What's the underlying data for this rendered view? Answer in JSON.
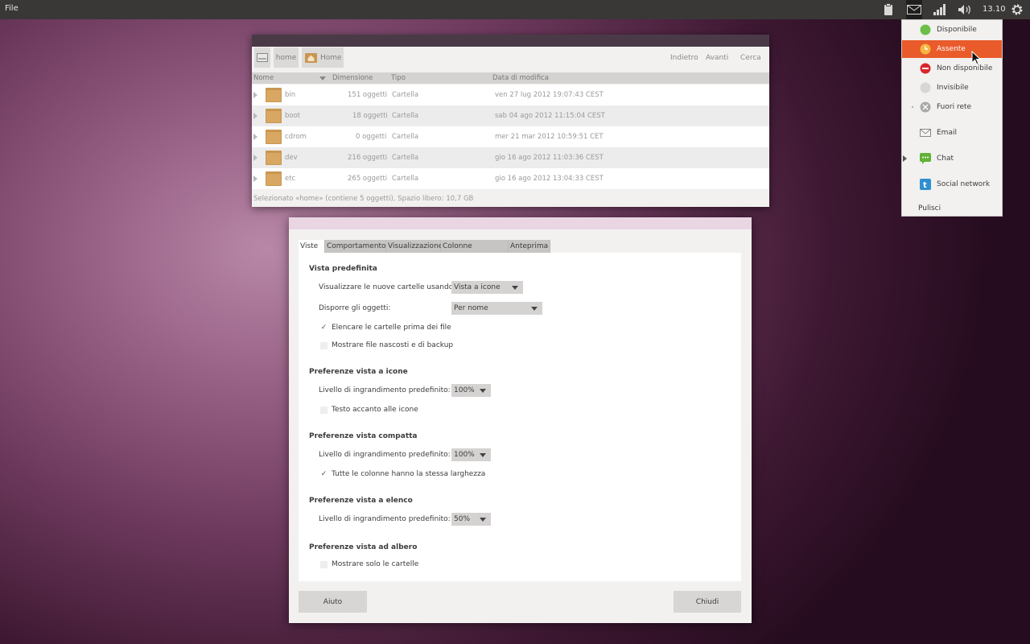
{
  "top_panel": {
    "menu_label": "File",
    "clock": "13.10",
    "tray_icons": [
      "clipboard-icon",
      "mail-icon",
      "network-signal-icon",
      "volume-icon",
      "gear-icon"
    ]
  },
  "indicator_menu": {
    "statuses": [
      {
        "label": "Disponibile",
        "icon": "status-available-icon",
        "color": "#6cc04a"
      },
      {
        "label": "Assente",
        "icon": "status-away-icon",
        "color": "#f0a02a"
      },
      {
        "label": "Non disponibile",
        "icon": "status-busy-icon",
        "color": "#d8262b"
      },
      {
        "label": "Invisibile",
        "icon": "status-invisible-icon",
        "color": "#cfcfcf"
      },
      {
        "label": "Fuori rete",
        "icon": "status-offline-icon",
        "color": "#a9a9a9"
      }
    ],
    "apps": [
      {
        "label": "Email",
        "icon": "email-icon"
      },
      {
        "label": "Chat",
        "icon": "chat-icon"
      },
      {
        "label": "Social network",
        "icon": "social-network-icon"
      }
    ],
    "clear_label": "Pulisci",
    "active_color": "#e95b2b"
  },
  "file_manager": {
    "breadcrumbs": [
      "home",
      "Home"
    ],
    "nav": {
      "back": "Indietro",
      "forward": "Avanti",
      "search": "Cerca"
    },
    "columns": [
      "Nome",
      "Dimensione",
      "Tipo",
      "Data di modifica"
    ],
    "rows": [
      {
        "name": "bin",
        "size": "151 oggetti",
        "type": "Cartella",
        "date": "ven 27 lug 2012 19:07:43 CEST"
      },
      {
        "name": "boot",
        "size": "18 oggetti",
        "type": "Cartella",
        "date": "sab 04 ago 2012 11:15:04 CEST"
      },
      {
        "name": "cdrom",
        "size": "0 oggetti",
        "type": "Cartella",
        "date": "mer 21 mar 2012 10:59:51 CET"
      },
      {
        "name": "dev",
        "size": "216 oggetti",
        "type": "Cartella",
        "date": "gio 16 ago 2012 11:03:36 CEST"
      },
      {
        "name": "etc",
        "size": "265 oggetti",
        "type": "Cartella",
        "date": "gio 16 ago 2012 13:04:33 CEST"
      }
    ],
    "status": "Selezionato «home» (contiene 5 oggetti), Spazio libero: 10,7 GB"
  },
  "prefs": {
    "tabs": [
      "Viste",
      "Comportamento",
      "Visualizzazione",
      "Colonne dell'elenco",
      "Anteprima"
    ],
    "default_view": {
      "title": "Vista predefinita",
      "new_folders_label": "Visualizzare le nuove cartelle usando:",
      "new_folders_value": "Vista a icone",
      "arrange_label": "Disporre gli oggetti:",
      "arrange_value": "Per nome",
      "folders_first": "Elencare le cartelle prima dei file",
      "show_hidden": "Mostrare file nascosti e di backup"
    },
    "icon_view": {
      "title": "Preferenze vista a icone",
      "zoom_label": "Livello di ingrandimento predefinito:",
      "zoom_value": "100%",
      "text_beside": "Testo accanto alle icone"
    },
    "compact_view": {
      "title": "Preferenze vista compatta",
      "zoom_label": "Livello di ingrandimento predefinito:",
      "zoom_value": "100%",
      "same_width": "Tutte le colonne hanno la stessa larghezza"
    },
    "list_view": {
      "title": "Preferenze vista a elenco",
      "zoom_label": "Livello di ingrandimento predefinito:",
      "zoom_value": "50%"
    },
    "tree_view": {
      "title": "Preferenze vista ad albero",
      "only_folders": "Mostrare solo le cartelle"
    },
    "help_label": "Aiuto",
    "close_label": "Chiudi"
  }
}
